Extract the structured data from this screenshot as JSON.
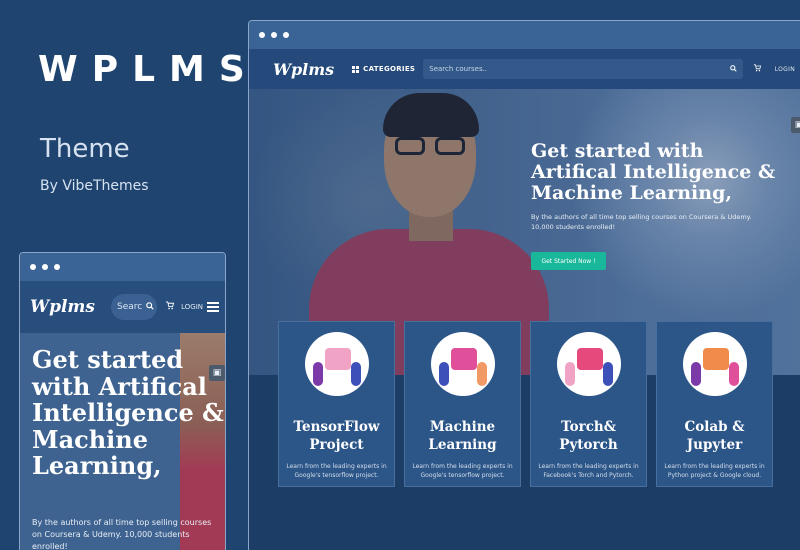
{
  "promo": {
    "title": "WPLMS",
    "subtitle": "Theme",
    "byline": "By VibeThemes"
  },
  "desktop": {
    "logo": "Wplms",
    "categories_label": "CATEGORIES",
    "search_placeholder": "Search courses..",
    "login_label": "LOGIN",
    "hero": {
      "heading": "Get started with Artifical Intelligence & Machine Learning,",
      "description": "By the authors of all time top selling courses on Coursera & Udemy. 10,000 students enrolled!",
      "cta_label": "Get Started Now !"
    },
    "cards": [
      {
        "title": "TensorFlow Project",
        "description": "Learn from the leading experts in Google's tensorflow project."
      },
      {
        "title": "Machine Learning",
        "description": "Learn from the leading experts in Google's tensorflow project."
      },
      {
        "title": "Torch& Pytorch",
        "description": "Learn from the leading experts in Facebook's Torch and Pytorch."
      },
      {
        "title": "Colab & Jupyter",
        "description": "Learn from the leading experts in Python project & Google cloud."
      }
    ]
  },
  "mobile": {
    "logo": "Wplms",
    "search_text": "Searc",
    "login_label": "LOGIN",
    "hero": {
      "heading": "Get started with Artifical Intelligence & Machine Learning,",
      "description": "By the authors of all time top selling courses on Coursera & Udemy. 10,000 students enrolled!"
    }
  },
  "colors": {
    "background": "#1f4470",
    "accent": "#1ab89a",
    "card": "#2d5688"
  }
}
